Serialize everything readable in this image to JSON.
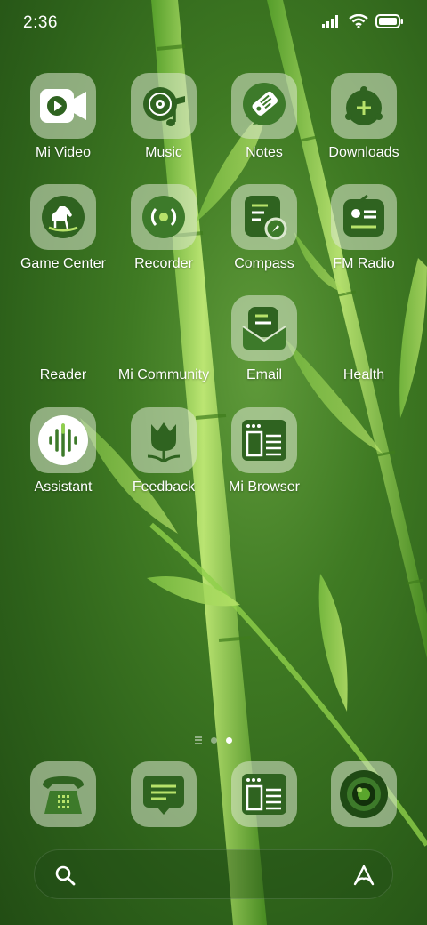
{
  "status_bar": {
    "time": "2:36",
    "icons": [
      "signal-icon",
      "wifi-icon",
      "battery-icon"
    ]
  },
  "apps": [
    {
      "label": "Mi Video",
      "icon": "video-icon"
    },
    {
      "label": "Music",
      "icon": "music-icon"
    },
    {
      "label": "Notes",
      "icon": "notes-tag-icon"
    },
    {
      "label": "Downloads",
      "icon": "downloads-icon"
    },
    {
      "label": "Game Center",
      "icon": "rocking-horse-icon"
    },
    {
      "label": "Recorder",
      "icon": "recorder-icon"
    },
    {
      "label": "Compass",
      "icon": "compass-icon"
    },
    {
      "label": "FM Radio",
      "icon": "radio-icon"
    },
    {
      "label": "Reader",
      "icon": ""
    },
    {
      "label": "Mi Community",
      "icon": ""
    },
    {
      "label": "Email",
      "icon": "email-icon"
    },
    {
      "label": "Health",
      "icon": ""
    },
    {
      "label": "Assistant",
      "icon": "assistant-waveform-icon"
    },
    {
      "label": "Feedback",
      "icon": "tulip-icon"
    },
    {
      "label": "Mi Browser",
      "icon": "browser-icon"
    }
  ],
  "page_indicator": {
    "pages": 2,
    "current": 2
  },
  "dock": [
    {
      "name": "phone",
      "icon": "phone-icon"
    },
    {
      "name": "messages",
      "icon": "message-icon"
    },
    {
      "name": "browser",
      "icon": "browser-icon"
    },
    {
      "name": "camera",
      "icon": "camera-icon"
    }
  ],
  "search": {
    "icons": [
      "search-icon",
      "assistant-a-icon"
    ]
  },
  "colors": {
    "accent_green": "#3d7a2a",
    "tile_bg": "#dce8d0",
    "icon_dark": "#2f6320"
  }
}
